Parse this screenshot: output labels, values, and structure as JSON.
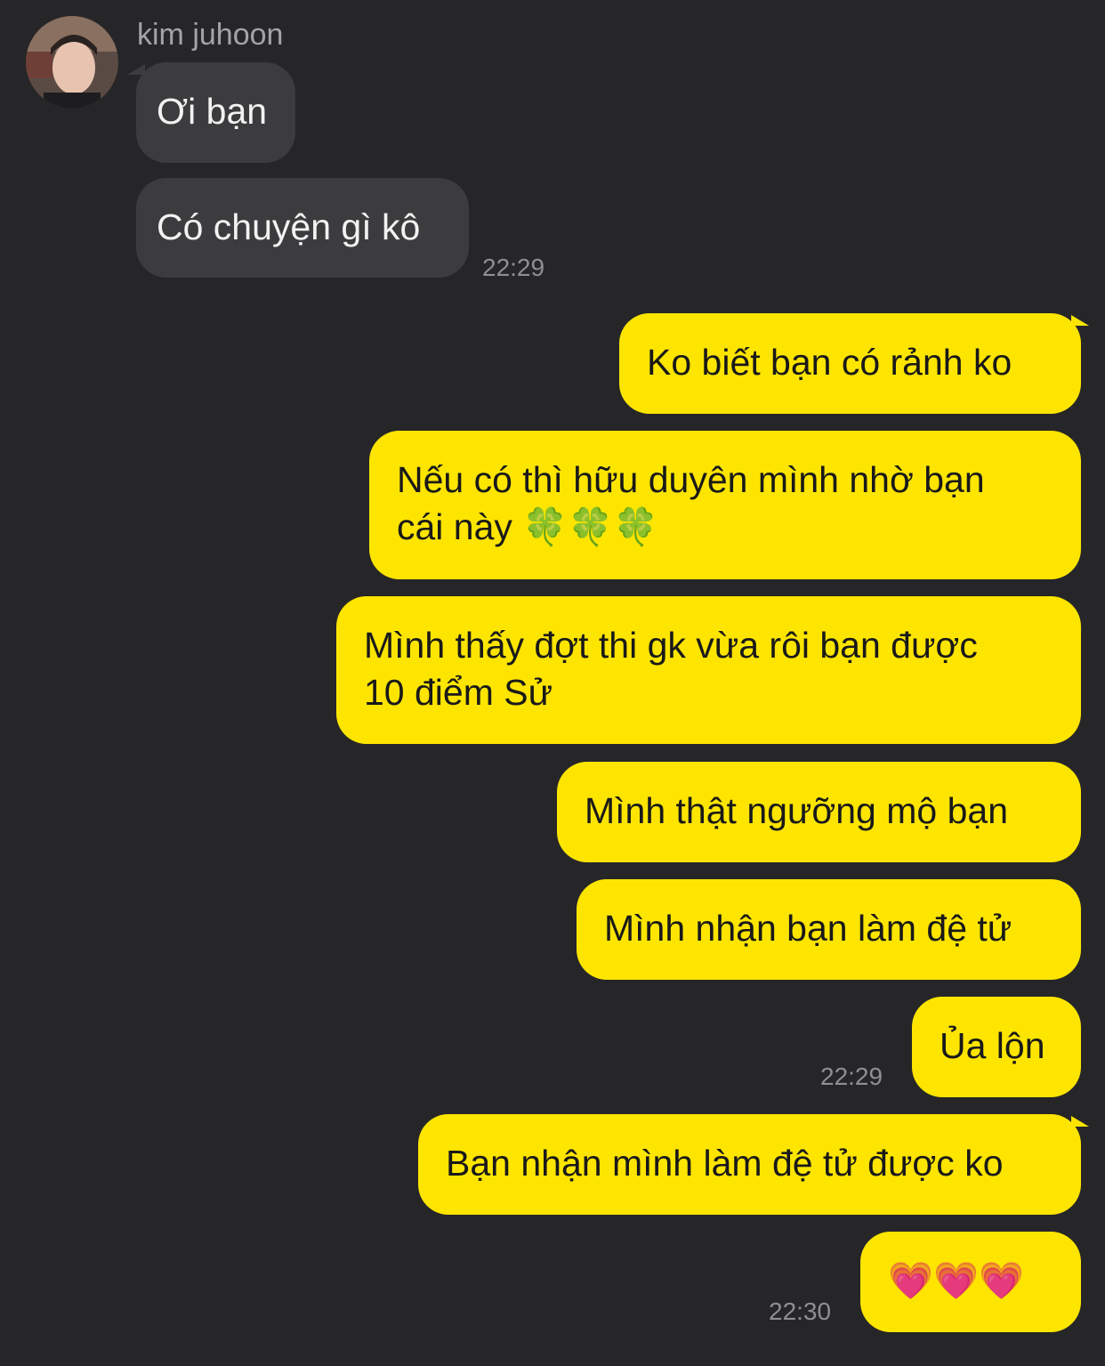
{
  "contact": {
    "name": "kim juhoon"
  },
  "messages": {
    "m1": "Ơi bạn",
    "m2": "Có chuyện gì kô",
    "m3": "Ko biết bạn có rảnh ko",
    "m4_line1": "Nếu có thì hữu duyên mình nhờ bạn",
    "m4_line2": "cái này 🍀🍀🍀",
    "m5_line1": "Mình thấy đợt thi gk vừa rôi bạn được",
    "m5_line2": "10 điểm Sử",
    "m6": "Mình thật ngưỡng mộ bạn",
    "m7": "Mình nhận bạn làm đệ tử",
    "m8": "Ủa lộn",
    "m9": "Bạn nhận mình làm đệ tử được ko",
    "m10": "💗💗💗"
  },
  "timestamps": {
    "t1": "22:29",
    "t2": "22:29",
    "t3": "22:30"
  },
  "colors": {
    "background": "#262628",
    "incoming_bubble": "#3c3c3e",
    "outgoing_bubble": "#fee500"
  }
}
